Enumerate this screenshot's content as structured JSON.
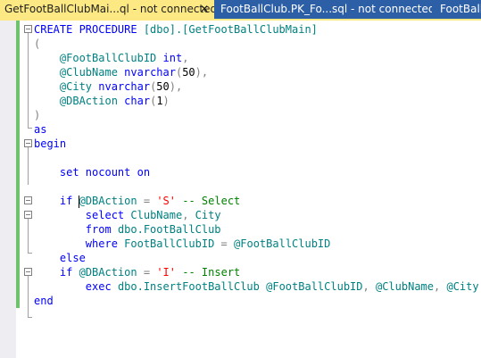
{
  "tabs": [
    {
      "label": "GetFootBallClubMai...ql - not connected",
      "close": "✕",
      "active": true
    },
    {
      "label": "FootBallClub.PK_Fo...sql - not connected",
      "active": false
    },
    {
      "label": "FootBallC",
      "active": false
    }
  ],
  "colors": {
    "tab_bar": "#2d5fa6",
    "active_tab": "#fde984",
    "keyword": "#0000ff",
    "object": "#008080",
    "string": "#ff0000",
    "comment": "#008000",
    "operator": "#808080",
    "change_bar": "#6cc36c"
  },
  "code": {
    "l1": {
      "kw": "CREATE PROCEDURE",
      "obj": "[dbo].[GetFootBallClubMain]"
    },
    "l2": {
      "op": "("
    },
    "l3": {
      "obj": "@FootBallClubID",
      "kw": "int",
      "op": ","
    },
    "l4": {
      "obj": "@ClubName",
      "kw": "nvarchar",
      "op1": "(",
      "num": "50",
      "op2": "),"
    },
    "l5": {
      "obj": "@City",
      "kw": "nvarchar",
      "op1": "(",
      "num": "50",
      "op2": "),"
    },
    "l6": {
      "obj": "@DBAction",
      "kw": "char",
      "op1": "(",
      "num": "1",
      "op2": ")"
    },
    "l7": {
      "op": ")"
    },
    "l8": {
      "kw": "as"
    },
    "l9": {
      "kw": "begin"
    },
    "l11": {
      "kw": "set nocount on"
    },
    "l13": {
      "kw": "if",
      "obj": "@DBAction",
      "op": "=",
      "str": "'S'",
      "cm": "-- Select"
    },
    "l14": {
      "kw": "select",
      "obj": "ClubName",
      "op": ",",
      "obj2": "City"
    },
    "l15": {
      "kw": "from",
      "obj": "dbo.FootBallClub"
    },
    "l16": {
      "kw": "where",
      "obj": "FootBallClubID",
      "op": "=",
      "obj2": "@FootBallClubID"
    },
    "l17": {
      "kw": "else"
    },
    "l18": {
      "kw": "if",
      "obj": "@DBAction",
      "op": "=",
      "str": "'I'",
      "cm": "-- Insert"
    },
    "l19": {
      "kw": "exec",
      "obj": "dbo.InsertFootBallClub",
      "a1": "@FootBallClubID",
      "c1": ",",
      "a2": "@ClubName",
      "c2": ",",
      "a3": "@City"
    },
    "l20": {
      "kw": "end"
    }
  }
}
